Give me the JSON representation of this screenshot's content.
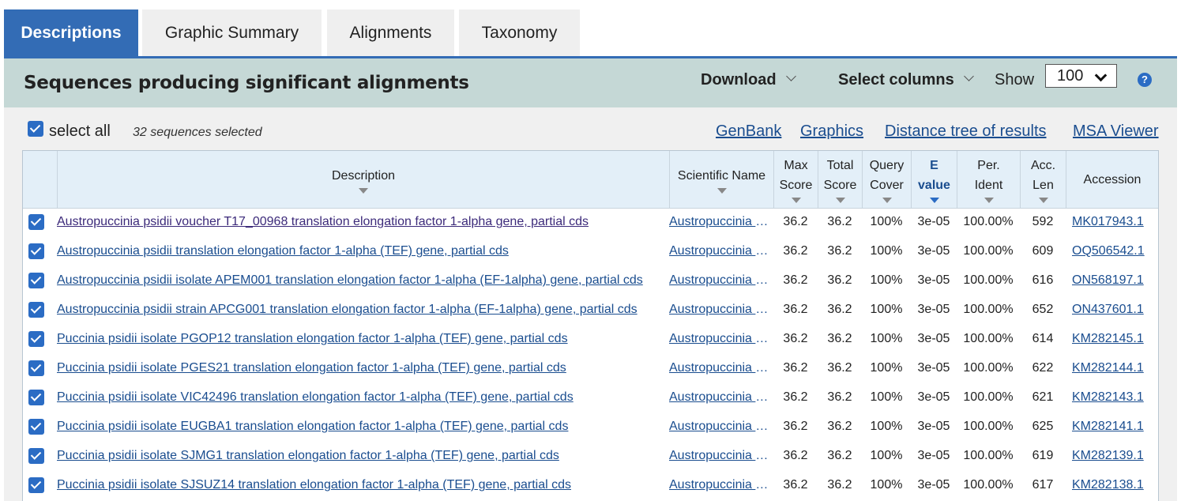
{
  "tabs": [
    "Descriptions",
    "Graphic Summary",
    "Alignments",
    "Taxonomy"
  ],
  "header": {
    "title": "Sequences producing significant alignments",
    "download": "Download",
    "select_columns": "Select columns",
    "show_label": "Show",
    "show_value": "100",
    "help": "?"
  },
  "toolbar": {
    "select_all": "select all",
    "selected_count": "32 sequences selected",
    "links": [
      "GenBank",
      "Graphics",
      "Distance tree of results",
      "MSA Viewer"
    ]
  },
  "columns": {
    "description": "Description",
    "scientific_name": "Scientific Name",
    "max_score": [
      "Max",
      "Score"
    ],
    "total_score": [
      "Total",
      "Score"
    ],
    "query_cover": [
      "Query",
      "Cover"
    ],
    "e_value": [
      "E",
      "value"
    ],
    "per_ident": [
      "Per.",
      "Ident"
    ],
    "acc_len": [
      "Acc.",
      "Len"
    ],
    "accession": "Accession"
  },
  "rows": [
    {
      "description": "Austropuccinia psidii voucher T17_00968 translation elongation factor 1-alpha gene, partial cds",
      "sci": "Austropuccinia psidii",
      "max": "36.2",
      "total": "36.2",
      "cover": "100%",
      "evalue": "3e-05",
      "ident": "100.00%",
      "len": "592",
      "acc": "MK017943.1",
      "visited": true
    },
    {
      "description": "Austropuccinia psidii translation elongation factor 1-alpha (TEF) gene, partial cds",
      "sci": "Austropuccinia psidii",
      "max": "36.2",
      "total": "36.2",
      "cover": "100%",
      "evalue": "3e-05",
      "ident": "100.00%",
      "len": "609",
      "acc": "OQ506542.1"
    },
    {
      "description": "Austropuccinia psidii isolate APEM001 translation elongation factor 1-alpha (EF-1alpha) gene, partial cds",
      "sci": "Austropuccinia psidii",
      "max": "36.2",
      "total": "36.2",
      "cover": "100%",
      "evalue": "3e-05",
      "ident": "100.00%",
      "len": "616",
      "acc": "ON568197.1"
    },
    {
      "description": "Austropuccinia psidii strain APCG001 translation elongation factor 1-alpha (EF-1alpha) gene, partial cds",
      "sci": "Austropuccinia psidii",
      "max": "36.2",
      "total": "36.2",
      "cover": "100%",
      "evalue": "3e-05",
      "ident": "100.00%",
      "len": "652",
      "acc": "ON437601.1"
    },
    {
      "description": "Puccinia psidii isolate PGOP12 translation elongation factor 1-alpha (TEF) gene, partial cds",
      "sci": "Austropuccinia psidii",
      "max": "36.2",
      "total": "36.2",
      "cover": "100%",
      "evalue": "3e-05",
      "ident": "100.00%",
      "len": "614",
      "acc": "KM282145.1"
    },
    {
      "description": "Puccinia psidii isolate PGES21 translation elongation factor 1-alpha (TEF) gene, partial cds",
      "sci": "Austropuccinia psidii",
      "max": "36.2",
      "total": "36.2",
      "cover": "100%",
      "evalue": "3e-05",
      "ident": "100.00%",
      "len": "622",
      "acc": "KM282144.1"
    },
    {
      "description": "Puccinia psidii isolate VIC42496 translation elongation factor 1-alpha (TEF) gene, partial cds",
      "sci": "Austropuccinia psidii",
      "max": "36.2",
      "total": "36.2",
      "cover": "100%",
      "evalue": "3e-05",
      "ident": "100.00%",
      "len": "621",
      "acc": "KM282143.1"
    },
    {
      "description": "Puccinia psidii isolate EUGBA1 translation elongation factor 1-alpha (TEF) gene, partial cds",
      "sci": "Austropuccinia psidii",
      "max": "36.2",
      "total": "36.2",
      "cover": "100%",
      "evalue": "3e-05",
      "ident": "100.00%",
      "len": "625",
      "acc": "KM282141.1"
    },
    {
      "description": "Puccinia psidii isolate SJMG1 translation elongation factor 1-alpha (TEF) gene, partial cds",
      "sci": "Austropuccinia psidii",
      "max": "36.2",
      "total": "36.2",
      "cover": "100%",
      "evalue": "3e-05",
      "ident": "100.00%",
      "len": "619",
      "acc": "KM282139.1"
    },
    {
      "description": "Puccinia psidii isolate SJSUZ14 translation elongation factor 1-alpha (TEF) gene, partial cds",
      "sci": "Austropuccinia psidii",
      "max": "36.2",
      "total": "36.2",
      "cover": "100%",
      "evalue": "3e-05",
      "ident": "100.00%",
      "len": "617",
      "acc": "KM282138.1"
    }
  ],
  "colors": {
    "accent": "#336cb5",
    "header_band": "#c5d8d6",
    "link": "#1a4d8f",
    "visited_link": "#3c2a7a",
    "table_header": "#e3eff8"
  }
}
